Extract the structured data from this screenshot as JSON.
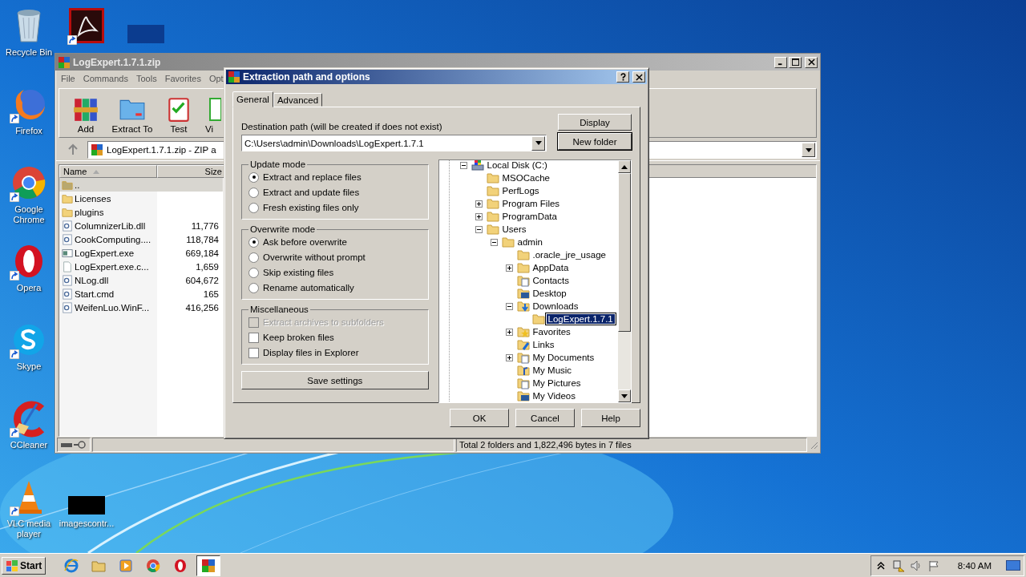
{
  "desktop_icons": [
    {
      "label": "Recycle Bin",
      "kind": "recycle-bin",
      "shortcut": false
    },
    {
      "kind": "acrobat",
      "shortcut": true
    },
    {
      "kind": "thumbnail-navy",
      "shortcut": false
    },
    {
      "label": "Firefox",
      "kind": "firefox",
      "shortcut": true
    },
    {
      "label": "Google Chrome",
      "kind": "chrome",
      "shortcut": true
    },
    {
      "label": "Opera",
      "kind": "opera",
      "shortcut": true
    },
    {
      "label": "Skype",
      "kind": "skype",
      "shortcut": true
    },
    {
      "label": "CCleaner",
      "kind": "ccleaner",
      "shortcut": true
    },
    {
      "label": "VLC media player",
      "kind": "vlc",
      "shortcut": true
    },
    {
      "label": "imagescontr...",
      "kind": "thumbnail-black",
      "shortcut": false
    }
  ],
  "archive_window": {
    "title": "LogExpert.1.7.1.zip",
    "menu": [
      "File",
      "Commands",
      "Tools",
      "Favorites",
      "Opt"
    ],
    "toolbar": [
      {
        "label": "Add",
        "kind": "add"
      },
      {
        "label": "Extract To",
        "kind": "extract"
      },
      {
        "label": "Test",
        "kind": "test"
      },
      {
        "label": "Vi",
        "kind": "view"
      }
    ],
    "address": "LogExpert.1.7.1.zip - ZIP a",
    "columns": [
      {
        "label": "Name",
        "sorted": true
      },
      {
        "label": "Size",
        "sorted": false
      }
    ],
    "rows": [
      {
        "name": "..",
        "kind": "folder-up",
        "selected": true
      },
      {
        "name": "Licenses",
        "kind": "folder",
        "selected": false
      },
      {
        "name": "plugins",
        "kind": "folder",
        "selected": false
      },
      {
        "name": "ColumnizerLib.dll",
        "size": "11,776",
        "kind": "dll",
        "selected": false
      },
      {
        "name": "CookComputing....",
        "size": "118,784",
        "kind": "dll",
        "selected": false
      },
      {
        "name": "LogExpert.exe",
        "size": "669,184",
        "kind": "exe",
        "selected": false
      },
      {
        "name": "LogExpert.exe.c...",
        "size": "1,659",
        "kind": "file",
        "selected": false
      },
      {
        "name": "NLog.dll",
        "size": "604,672",
        "kind": "dll",
        "selected": false
      },
      {
        "name": "Start.cmd",
        "size": "165",
        "kind": "cmd",
        "selected": false
      },
      {
        "name": "WeifenLuo.WinF...",
        "size": "416,256",
        "kind": "dll",
        "selected": false
      }
    ],
    "status_bar": "Total 2 folders and 1,822,496 bytes in 7 files"
  },
  "dialog": {
    "title": "Extraction path and options",
    "tabs": [
      {
        "label": "General",
        "selected": true
      },
      {
        "label": "Advanced",
        "selected": false
      }
    ],
    "destination": {
      "label": "Destination path (will be created if does not exist)",
      "value": "C:\\Users\\admin\\Downloads\\LogExpert.1.7.1"
    },
    "side_buttons": [
      {
        "label": "Display",
        "default": false
      },
      {
        "label": "New folder",
        "default": true
      }
    ],
    "update_mode": {
      "title": "Update mode",
      "options": [
        {
          "label": "Extract and replace files",
          "selected": true
        },
        {
          "label": "Extract and update files",
          "selected": false
        },
        {
          "label": "Fresh existing files only",
          "selected": false
        }
      ]
    },
    "overwrite_mode": {
      "title": "Overwrite mode",
      "options": [
        {
          "label": "Ask before overwrite",
          "selected": true
        },
        {
          "label": "Overwrite without prompt",
          "selected": false
        },
        {
          "label": "Skip existing files",
          "selected": false
        },
        {
          "label": "Rename automatically",
          "selected": false
        }
      ]
    },
    "miscellaneous": {
      "title": "Miscellaneous",
      "options": [
        {
          "label": "Extract archives to subfolders",
          "checked": false,
          "disabled": true
        },
        {
          "label": "Keep broken files",
          "checked": false,
          "disabled": false
        },
        {
          "label": "Display files in Explorer",
          "checked": false,
          "disabled": false
        }
      ]
    },
    "save_button": "Save settings",
    "tree": [
      {
        "label": "Local Disk (C:)",
        "kind": "drive",
        "expandable": true,
        "expanded": true,
        "selected": false,
        "children": [
          {
            "label": "MSOCache",
            "kind": "folder",
            "expandable": false,
            "expanded": false,
            "selected": false
          },
          {
            "label": "PerfLogs",
            "kind": "folder",
            "expandable": false,
            "expanded": false,
            "selected": false
          },
          {
            "label": "Program Files",
            "kind": "folder",
            "expandable": true,
            "expanded": false,
            "selected": false
          },
          {
            "label": "ProgramData",
            "kind": "folder",
            "expandable": true,
            "expanded": false,
            "selected": false
          },
          {
            "label": "Users",
            "kind": "folder",
            "expandable": true,
            "expanded": true,
            "selected": false,
            "children": [
              {
                "label": "admin",
                "kind": "folder",
                "expandable": true,
                "expanded": true,
                "selected": false,
                "children": [
                  {
                    "label": ".oracle_jre_usage",
                    "kind": "folder",
                    "expandable": false,
                    "expanded": false,
                    "selected": false
                  },
                  {
                    "label": "AppData",
                    "kind": "folder",
                    "expandable": true,
                    "expanded": false,
                    "selected": false
                  },
                  {
                    "label": "Contacts",
                    "kind": "contacts",
                    "expandable": false,
                    "expanded": false,
                    "selected": false
                  },
                  {
                    "label": "Desktop",
                    "kind": "desktop",
                    "expandable": false,
                    "expanded": false,
                    "selected": false
                  },
                  {
                    "label": "Downloads",
                    "kind": "downloads",
                    "expandable": true,
                    "expanded": true,
                    "selected": false,
                    "children": [
                      {
                        "label": "LogExpert.1.7.1",
                        "kind": "folder",
                        "expandable": false,
                        "expanded": false,
                        "selected": true
                      }
                    ]
                  },
                  {
                    "label": "Favorites",
                    "kind": "favorites",
                    "expandable": true,
                    "expanded": false,
                    "selected": false
                  },
                  {
                    "label": "Links",
                    "kind": "links",
                    "expandable": false,
                    "expanded": false,
                    "selected": false
                  },
                  {
                    "label": "My Documents",
                    "kind": "documents",
                    "expandable": true,
                    "expanded": false,
                    "selected": false
                  },
                  {
                    "label": "My Music",
                    "kind": "music",
                    "expandable": false,
                    "expanded": false,
                    "selected": false
                  },
                  {
                    "label": "My Pictures",
                    "kind": "pictures",
                    "expandable": false,
                    "expanded": false,
                    "selected": false
                  },
                  {
                    "label": "My Videos",
                    "kind": "videos",
                    "expandable": false,
                    "expanded": false,
                    "selected": false
                  }
                ]
              }
            ]
          }
        ]
      }
    ],
    "buttons": [
      "OK",
      "Cancel",
      "Help"
    ]
  },
  "taskbar": {
    "start": "Start",
    "apps": [
      {
        "kind": "internet-explorer",
        "active": false
      },
      {
        "kind": "file-explorer",
        "active": false
      },
      {
        "kind": "media-player",
        "active": false
      },
      {
        "kind": "chrome",
        "active": false
      },
      {
        "kind": "opera",
        "active": false
      },
      {
        "kind": "winrar",
        "active": true
      }
    ],
    "clock": "8:40 AM"
  }
}
